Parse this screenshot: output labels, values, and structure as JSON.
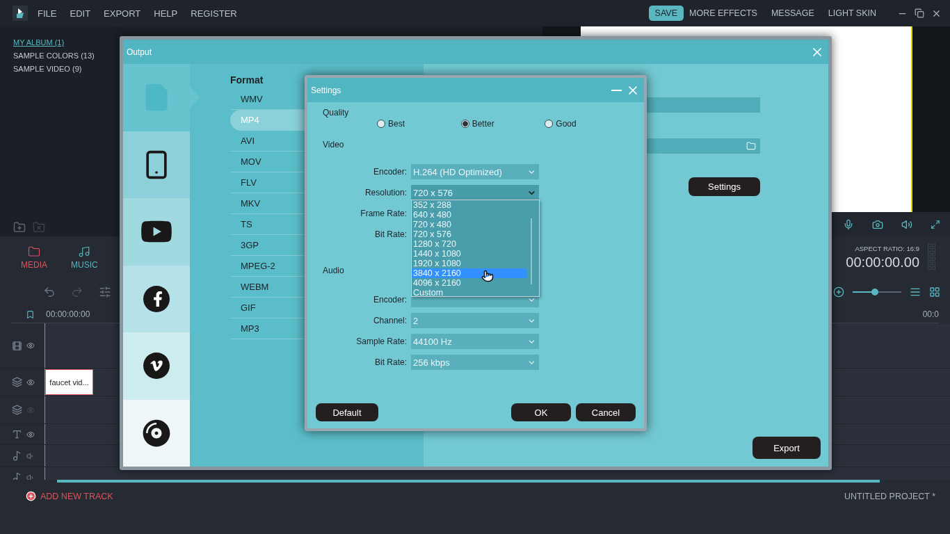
{
  "menu": [
    "FILE",
    "EDIT",
    "EXPORT",
    "HELP",
    "REGISTER"
  ],
  "top_actions": [
    {
      "label": "SAVE",
      "kind": "primary"
    },
    {
      "label": "MORE EFFECTS",
      "kind": "plain"
    },
    {
      "label": "MESSAGE",
      "kind": "plain"
    },
    {
      "label": "LIGHT SKIN",
      "kind": "plain"
    }
  ],
  "library": [
    {
      "label": "MY ALBUM (1)",
      "selected": true
    },
    {
      "label": "SAMPLE COLORS (13)",
      "selected": false
    },
    {
      "label": "SAMPLE VIDEO (9)",
      "selected": false
    }
  ],
  "media_tabs": [
    {
      "label": "MEDIA",
      "kind": "media",
      "selected": true
    },
    {
      "label": "MUSIC",
      "kind": "music",
      "selected": false
    }
  ],
  "preview": {
    "aspect_ratio": "ASPECT RATIO: 16:9",
    "timecode": "00:00:00.00"
  },
  "timeline": {
    "zoom": {
      "level": 0.46
    },
    "start_time": "00:00:00:00",
    "end_time": "00:0",
    "tracks": [
      {
        "kind": "video",
        "visible": true
      },
      {
        "kind": "overlay",
        "visible": true,
        "clip": "faucet vid..."
      },
      {
        "kind": "overlay",
        "visible": false
      },
      {
        "kind": "text",
        "visible": true
      },
      {
        "kind": "audio"
      },
      {
        "kind": "audio"
      }
    ],
    "add_track": "ADD NEW TRACK",
    "project": "UNTITLED PROJECT *"
  },
  "output": {
    "title": "Output",
    "targets": [
      {
        "kind": "file",
        "selected": true
      },
      {
        "kind": "device",
        "selected": false
      },
      {
        "kind": "youtube",
        "selected": false
      },
      {
        "kind": "facebook",
        "selected": false
      },
      {
        "kind": "vimeo",
        "selected": false
      },
      {
        "kind": "disc",
        "selected": false
      }
    ],
    "format_heading": "Format",
    "formats": [
      {
        "label": "WMV",
        "selected": false
      },
      {
        "label": "MP4",
        "selected": true
      },
      {
        "label": "AVI",
        "selected": false
      },
      {
        "label": "MOV",
        "selected": false
      },
      {
        "label": "FLV",
        "selected": false
      },
      {
        "label": "MKV",
        "selected": false
      },
      {
        "label": "TS",
        "selected": false
      },
      {
        "label": "3GP",
        "selected": false
      },
      {
        "label": "MPEG-2",
        "selected": false
      },
      {
        "label": "WEBM",
        "selected": false
      },
      {
        "label": "GIF",
        "selected": false
      },
      {
        "label": "MP3",
        "selected": false
      }
    ],
    "settings_button": "Settings",
    "export_button": "Export"
  },
  "settings": {
    "title": "Settings",
    "quality_label": "Quality",
    "quality": [
      {
        "label": "Best",
        "selected": false
      },
      {
        "label": "Better",
        "selected": true
      },
      {
        "label": "Good",
        "selected": false
      }
    ],
    "video_label": "Video",
    "video_rows": [
      {
        "label": "Encoder:",
        "value": "H.264 (HD Optimized)",
        "open": false
      },
      {
        "label": "Resolution:",
        "value": "720 x 576",
        "open": true
      },
      {
        "label": "Frame Rate:"
      },
      {
        "label": "Bit Rate:"
      }
    ],
    "audio_label": "Audio",
    "audio_rows": [
      {
        "label": "Encoder:",
        "open": false
      },
      {
        "label": "Channel:",
        "value": "2",
        "open": false
      },
      {
        "label": "Sample Rate:",
        "value": "44100 Hz",
        "open": false
      },
      {
        "label": "Bit Rate:",
        "value": "256 kbps",
        "open": false
      }
    ],
    "resolution_options": [
      {
        "label": "352 x 288",
        "selected": false
      },
      {
        "label": "640 x 480",
        "selected": false
      },
      {
        "label": "720 x 480",
        "selected": false
      },
      {
        "label": "720 x 576",
        "selected": false
      },
      {
        "label": "1280 x 720",
        "selected": false
      },
      {
        "label": "1440 x 1080",
        "selected": false
      },
      {
        "label": "1920 x 1080",
        "selected": false
      },
      {
        "label": "3840 x 2160",
        "selected": true
      },
      {
        "label": "4096 x 2160",
        "selected": false
      },
      {
        "label": "Custom",
        "selected": false
      }
    ],
    "buttons": {
      "default": "Default",
      "ok": "OK",
      "cancel": "Cancel"
    }
  }
}
